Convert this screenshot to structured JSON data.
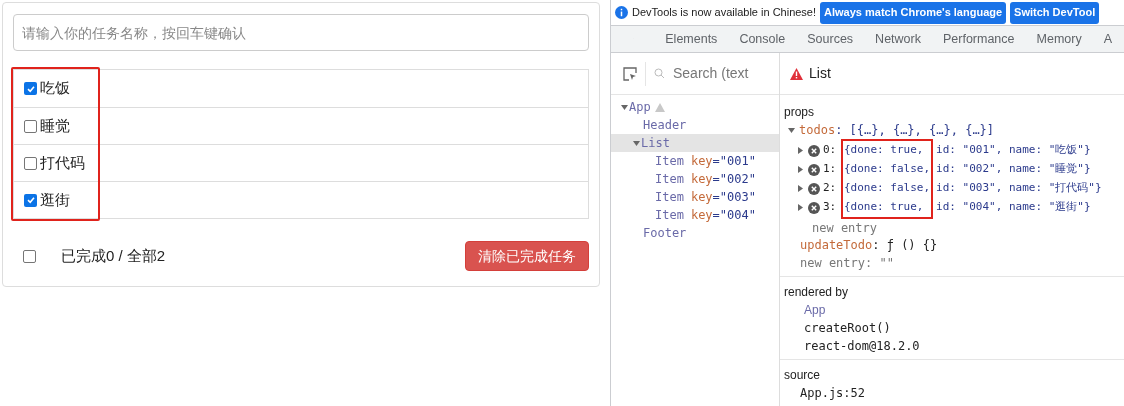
{
  "todo_app": {
    "input": {
      "placeholder": "请输入你的任务名称，按回车键确认"
    },
    "items": [
      {
        "name": "吃饭",
        "checked": true
      },
      {
        "name": "睡觉",
        "checked": false
      },
      {
        "name": "打代码",
        "checked": false
      },
      {
        "name": "逛街",
        "checked": true
      }
    ],
    "footer": {
      "all_checked": false,
      "summary": "已完成0 / 全部2",
      "clear_button": "清除已完成任务"
    }
  },
  "devtools": {
    "banner": {
      "message": "DevTools is now available in Chinese!",
      "buttons": [
        "Always match Chrome's language",
        "Switch DevTool"
      ]
    },
    "tabs": [
      {
        "label": "Elements",
        "selected": false
      },
      {
        "label": "Console",
        "selected": false
      },
      {
        "label": "Sources",
        "selected": false
      },
      {
        "label": "Network",
        "selected": false
      },
      {
        "label": "Performance",
        "selected": false
      },
      {
        "label": "Memory",
        "selected": false
      },
      {
        "label": "A",
        "selected": false
      }
    ],
    "search": {
      "placeholder": "Search (text"
    },
    "component_title": "List",
    "tree": [
      {
        "name": "App",
        "warning": true,
        "expanded": true,
        "selected": false,
        "children": [
          {
            "name": "Header",
            "selected": false
          },
          {
            "name": "List",
            "expanded": true,
            "selected": true,
            "children": [
              {
                "name": "Item",
                "attr_name": "key",
                "attr_value": "=\"001\"",
                "selected": false
              },
              {
                "name": "Item",
                "attr_name": "key",
                "attr_value": "=\"002\"",
                "selected": false
              },
              {
                "name": "Item",
                "attr_name": "key",
                "attr_value": "=\"003\"",
                "selected": false
              },
              {
                "name": "Item",
                "attr_name": "key",
                "attr_value": "=\"004\"",
                "selected": false
              }
            ]
          },
          {
            "name": "Footer",
            "selected": false
          }
        ]
      }
    ],
    "props": {
      "heading": "props",
      "todos_key": "todos",
      "todos_value": ": [{…}, {…}, {…}, {…}]",
      "todos": [
        {
          "index": "0:",
          "head": "{done: true,",
          "tail": "id: \"001\", name: \"吃饭\"}"
        },
        {
          "index": "1:",
          "head": "{done: false,",
          "tail": "id: \"002\", name: \"睡觉\"}"
        },
        {
          "index": "2:",
          "head": "{done: false,",
          "tail": "id: \"003\", name: \"打代码\"}"
        },
        {
          "index": "3:",
          "head": "{done: true,",
          "tail": "id: \"004\", name: \"逛街\"}"
        }
      ],
      "new_entry_inner": "new entry",
      "update_key": "updateTodo",
      "update_value": ": ƒ () {}",
      "new_entry": "new entry: \"\""
    },
    "rendered_by": {
      "heading": "rendered by",
      "owner": "App",
      "lines": [
        "createRoot()",
        "react-dom@18.2.0"
      ]
    },
    "source": {
      "heading": "source",
      "file": "App.js:52"
    }
  }
}
